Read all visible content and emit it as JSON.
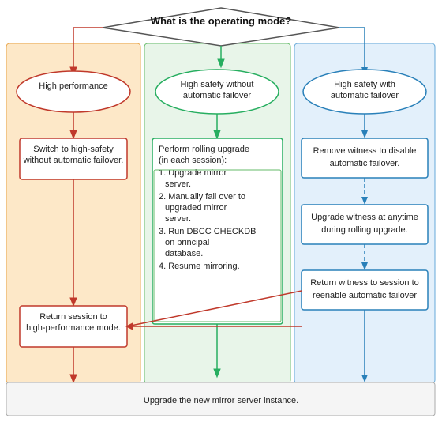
{
  "diagram": {
    "title": "What is the operating mode?",
    "col1": {
      "label": "High performance",
      "box1": "Switch to high-safety\nwithout automatic failover.",
      "box2": "Return session to\nhigh-performance mode."
    },
    "col2": {
      "label": "High safety without\nautomatic failover",
      "box": "Perform rolling upgrade\n(in each session):\n1. Upgrade mirror server.\n2. Manually fail over to upgraded mirror server.\n3. Run DBCC CHECKDB on principal database.\n4. Resume mirroring."
    },
    "col3": {
      "label": "High safety with\nautomatic failover",
      "box1": "Remove witness to disable\nautomatic failover.",
      "box2": "Upgrade witness at anytime\nduring rolling upgrade.",
      "box3": "Return witness to session to\nreenable automatic failover"
    },
    "bottom": "Upgrade the new mirror server instance."
  }
}
